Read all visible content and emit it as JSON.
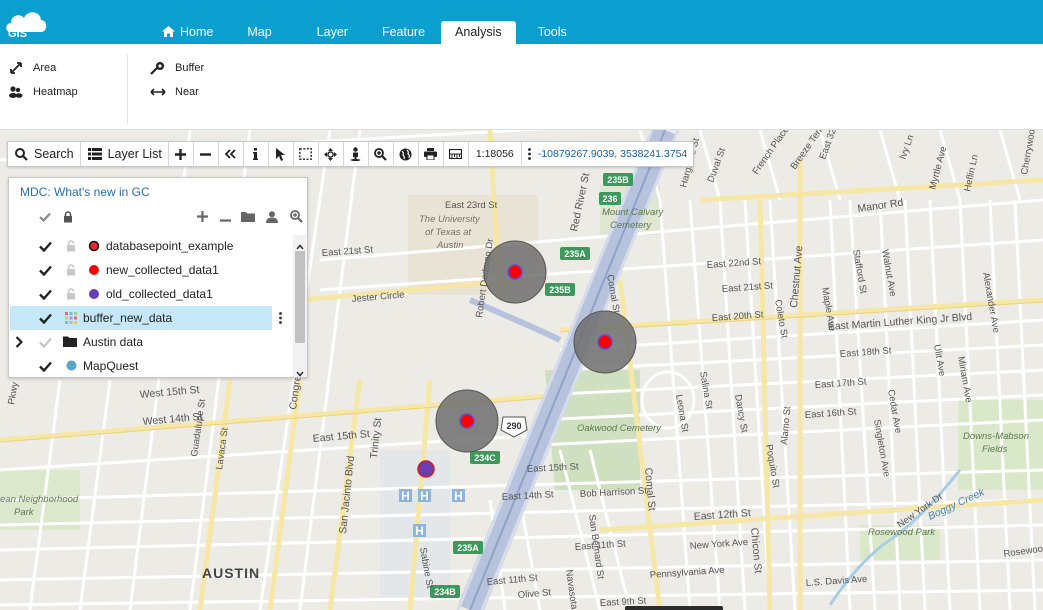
{
  "app": {
    "logo_text": "GIS",
    "tabs": [
      {
        "label": "Home",
        "icon": "home-icon"
      },
      {
        "label": "Map"
      },
      {
        "label": "Layer"
      },
      {
        "label": "Feature"
      },
      {
        "label": "Analysis",
        "active": true
      },
      {
        "label": "Tools"
      }
    ],
    "accent_color": "#0b9fd0"
  },
  "ribbon": {
    "area_label": "Area",
    "heatmap_label": "Heatmap",
    "buffer_label": "Buffer",
    "near_label": "Near"
  },
  "toolbar": {
    "search_label": "Search",
    "layerlist_label": "Layer List",
    "scale": "1:18056",
    "coordinates": "-10879267.9039, 3538241.3754"
  },
  "layer_panel": {
    "title": "MDC: What's new in GC",
    "layers": [
      {
        "name": "databasepoint_example",
        "symbol": "point-red-black-outline"
      },
      {
        "name": "new_collected_data1",
        "symbol": "point-red"
      },
      {
        "name": "old_collected_data1",
        "symbol": "point-purple"
      },
      {
        "name": "buffer_new_data",
        "symbol": "polygon-grid",
        "selected": true
      },
      {
        "name": "Austin data",
        "symbol": "folder",
        "expandable": true
      },
      {
        "name": "MapQuest",
        "symbol": "globe"
      }
    ]
  },
  "map": {
    "labels": {
      "ut1": "The University",
      "ut2": "of Texas at",
      "ut3": "Austin",
      "austin": "AUSTIN",
      "oakwood": "Oakwood Cemetery",
      "mtcalvary1": "Mount Calvary",
      "mtcalvary2": "Cemetery",
      "downsmabson1": "Downs-Mabson",
      "downsmabson2": "Fields",
      "rosewood_park": "Rosewood Park",
      "neighborhood1": "ean Neighborhood",
      "neighborhood2": "Park",
      "boggy": "Boggy Creek",
      "e23": "East 23rd St",
      "e21": "East 21st St",
      "jester": "Jester Circle",
      "e22": "East 22nd St",
      "e21b": "East 21st St",
      "e20": "East 20th St",
      "mlk": "East Martin Luther King Jr Blvd",
      "e18": "East 18th St",
      "e17": "East 17th St",
      "e16": "East 16th St",
      "e15": "East 15th St",
      "w15": "West 15th St",
      "w14": "West 14th St",
      "e15b": "East 15th St",
      "e14": "East 14th St",
      "e13": "East 13th St",
      "e12": "East 12th St",
      "e11": "East 11th St",
      "manor": "Manor Rd",
      "redriver": "Red River St",
      "comal": "Comal St",
      "comal2": "Comal St",
      "chestnut": "Chestnut Ave",
      "chicon": "Chicon St",
      "newyork": "New York Ave",
      "newyork2": "New York Dr",
      "pennsylvania": "Pennsylvania Ave",
      "davis": "L.S. Davis Ave",
      "rosewood": "Rosewood",
      "congress": "Congress Ave",
      "trinity": "Trinity St",
      "sanjacinto": "San Jacinto Blvd",
      "guadalupe": "Guadalupe St",
      "lavaca": "Lavaca St",
      "sabine": "Sabine St",
      "navasota": "Navasota St",
      "sanbernard": "San Bernard St",
      "bobharrison": "Bob Harrison St",
      "e9": "East 9th St",
      "leona": "Leona St",
      "salina": "Salina St",
      "dancy": "Dancy St",
      "alamo": "Alamo St",
      "singleton": "Singleton Ave",
      "cedar": "Cedar Ave",
      "ulit": "Ulit Ave",
      "miriam": "Miriam Ave",
      "alexander": "Alexander Ave",
      "walnut": "Walnut Ave",
      "maple": "Maple Ave",
      "stafford": "Stafford St",
      "poquito": "Poquito St",
      "coleto": "Coleto St",
      "robertdedman": "Robert Dedman Dr",
      "oliveSt": "Olive St",
      "hargrave": "Hargrave St",
      "e32": "East 32nd St",
      "lafayette": "Lafayette",
      "french": "French Place",
      "breeze": "Breeze Terrace",
      "duval": "Duval St",
      "ivy": "Ivy Ln",
      "myrtle": "Myrtle Ave",
      "heflin": "Heflin Ln",
      "oakgrove": "Oak Grove Ave",
      "penny": "Pennsylvania Ln",
      "w15b": "West 15th St",
      "pkwy": "Pkwy",
      "e32b": "East 32nd St",
      "cherrywood": "Cherrywood"
    },
    "shields": {
      "s235b_top": "235B",
      "s236": "236",
      "s235a_top": "235A",
      "s235b_mid": "235B",
      "s234c": "234C",
      "s235a_bot": "235A",
      "s234b": "234B",
      "us290": "290"
    },
    "colors": {
      "buffer_fill": "#6e6e6e",
      "point_red": "#ff0000",
      "point_purple": "#6a3db0",
      "interstate": "#a9b7d6"
    }
  }
}
